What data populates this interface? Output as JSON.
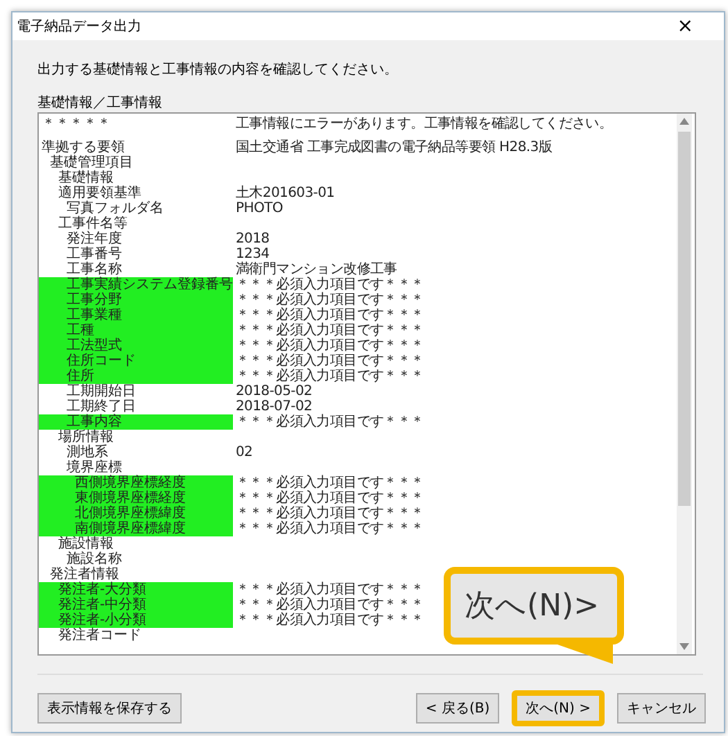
{
  "window": {
    "title": "電子納品データ出力",
    "close": "×"
  },
  "instruction": "出力する基礎情報と工事情報の内容を確認してください。",
  "list_label": "基礎情報／工事情報",
  "rows": [
    {
      "label": "＊＊＊＊＊",
      "value": "工事情報にエラーがあります。工事情報を確認してください。",
      "error": false
    },
    {
      "label": "準拠する要領",
      "value": "国土交通省 工事完成図書の電子納品等要領 H28.3版",
      "error": false,
      "children": [
        {
          "label": "基礎管理項目",
          "error": false,
          "children": [
            {
              "label": "基礎情報",
              "error": false
            },
            {
              "label": "適用要領基準",
              "value": "土木201603-01",
              "error": false,
              "children": [
                {
                  "label": "写真フォルダ名",
                  "value": "PHOTO",
                  "error": false
                }
              ]
            },
            {
              "label": "工事件名等",
              "error": false,
              "children": [
                {
                  "label": "発注年度",
                  "value": "2018",
                  "error": false
                },
                {
                  "label": "工事番号",
                  "value": "1234",
                  "error": false
                },
                {
                  "label": "工事名称",
                  "value": "満衛門マンション改修工事",
                  "error": false
                },
                {
                  "label": "工事実績システム登録番号",
                  "value": "＊＊＊必須入力項目です＊＊＊",
                  "error": true
                },
                {
                  "label": "工事分野",
                  "value": "＊＊＊必須入力項目です＊＊＊",
                  "error": true
                },
                {
                  "label": "工事業種",
                  "value": "＊＊＊必須入力項目です＊＊＊",
                  "error": true
                },
                {
                  "label": "工種",
                  "value": "＊＊＊必須入力項目です＊＊＊",
                  "error": true
                },
                {
                  "label": "工法型式",
                  "value": "＊＊＊必須入力項目です＊＊＊",
                  "error": true
                },
                {
                  "label": "住所コード",
                  "value": "＊＊＊必須入力項目です＊＊＊",
                  "error": true
                },
                {
                  "label": "住所",
                  "value": "＊＊＊必須入力項目です＊＊＊",
                  "error": true
                },
                {
                  "label": "工期開始日",
                  "value": "2018-05-02",
                  "error": false
                },
                {
                  "label": "工期終了日",
                  "value": "2018-07-02",
                  "error": false
                },
                {
                  "label": "工事内容",
                  "value": "＊＊＊必須入力項目です＊＊＊",
                  "error": true
                }
              ]
            },
            {
              "label": "場所情報",
              "error": false,
              "children": [
                {
                  "label": "測地系",
                  "value": "02",
                  "error": false
                },
                {
                  "label": "境界座標",
                  "error": false,
                  "children": [
                    {
                      "label": "西側境界座標経度",
                      "value": "＊＊＊必須入力項目です＊＊＊",
                      "error": true
                    },
                    {
                      "label": "東側境界座標経度",
                      "value": "＊＊＊必須入力項目です＊＊＊",
                      "error": true
                    },
                    {
                      "label": "北側境界座標緯度",
                      "value": "＊＊＊必須入力項目です＊＊＊",
                      "error": true
                    },
                    {
                      "label": "南側境界座標緯度",
                      "value": "＊＊＊必須入力項目です＊＊＊",
                      "error": true
                    }
                  ]
                }
              ]
            },
            {
              "label": "施設情報",
              "error": false,
              "children": [
                {
                  "label": "施設名称",
                  "error": false
                }
              ]
            }
          ]
        },
        {
          "label": "発注者情報",
          "error": false,
          "children": [
            {
              "label": "発注者-大分類",
              "value": "＊＊＊必須入力項目です＊＊＊",
              "error": true
            },
            {
              "label": "発注者-中分類",
              "value": "＊＊＊必須入力項目です＊＊＊",
              "error": true
            },
            {
              "label": "発注者-小分類",
              "value": "＊＊＊必須入力項目です＊＊＊",
              "error": true
            },
            {
              "label": "発注者コード",
              "error": false
            }
          ]
        }
      ]
    }
  ],
  "save_button": "表示情報を保存する",
  "buttons": [
    {
      "label": "< 戻る(B)",
      "highlighted": false
    },
    {
      "label": "次へ(N) >",
      "highlighted": true
    },
    {
      "label": "キャンセル",
      "highlighted": false
    }
  ],
  "callout": {
    "text": "次へ(N)>"
  }
}
